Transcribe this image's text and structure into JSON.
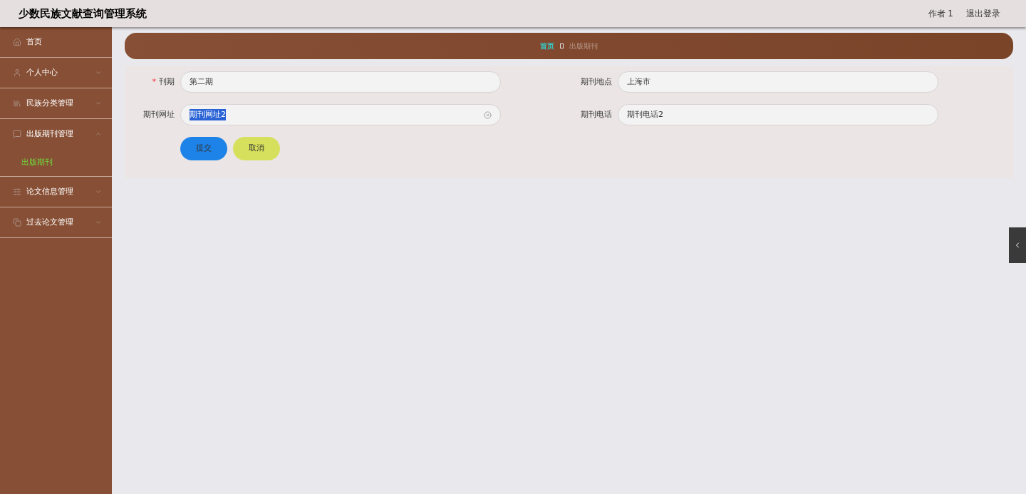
{
  "header": {
    "title": "少数民族文献查询管理系统",
    "user": "作者 1",
    "logout": "退出登录"
  },
  "sidebar": {
    "items": [
      {
        "label": "首页",
        "kind": "link"
      },
      {
        "label": "个人中心",
        "kind": "group",
        "expanded": false
      },
      {
        "label": "民族分类管理",
        "kind": "group",
        "expanded": false
      },
      {
        "label": "出版期刊管理",
        "kind": "group",
        "expanded": true,
        "children": [
          {
            "label": "出版期刊",
            "selected": true
          }
        ]
      },
      {
        "label": "论文信息管理",
        "kind": "group",
        "expanded": false
      },
      {
        "label": "过去论文管理",
        "kind": "group",
        "expanded": false
      }
    ]
  },
  "breadcrumb": [
    {
      "label": "首页",
      "selected": true
    },
    {
      "label": "出版期刊",
      "selected": false
    }
  ],
  "form": {
    "fields": [
      {
        "label": "刊期",
        "value": "第二期",
        "required_mark": "*",
        "text_selected": false,
        "clearable": false
      },
      {
        "label": "期刊地点",
        "value": "上海市",
        "text_selected": false,
        "clearable": false
      },
      {
        "label": "期刊网址",
        "value": "期刊网址2",
        "text_selected": true,
        "clearable": true
      },
      {
        "label": "期刊电话",
        "value": "期刊电话2",
        "text_selected": false,
        "clearable": false
      }
    ],
    "buttons": [
      {
        "label": "提交",
        "kind": "primary"
      },
      {
        "label": "取消",
        "kind": "secondary"
      }
    ]
  }
}
